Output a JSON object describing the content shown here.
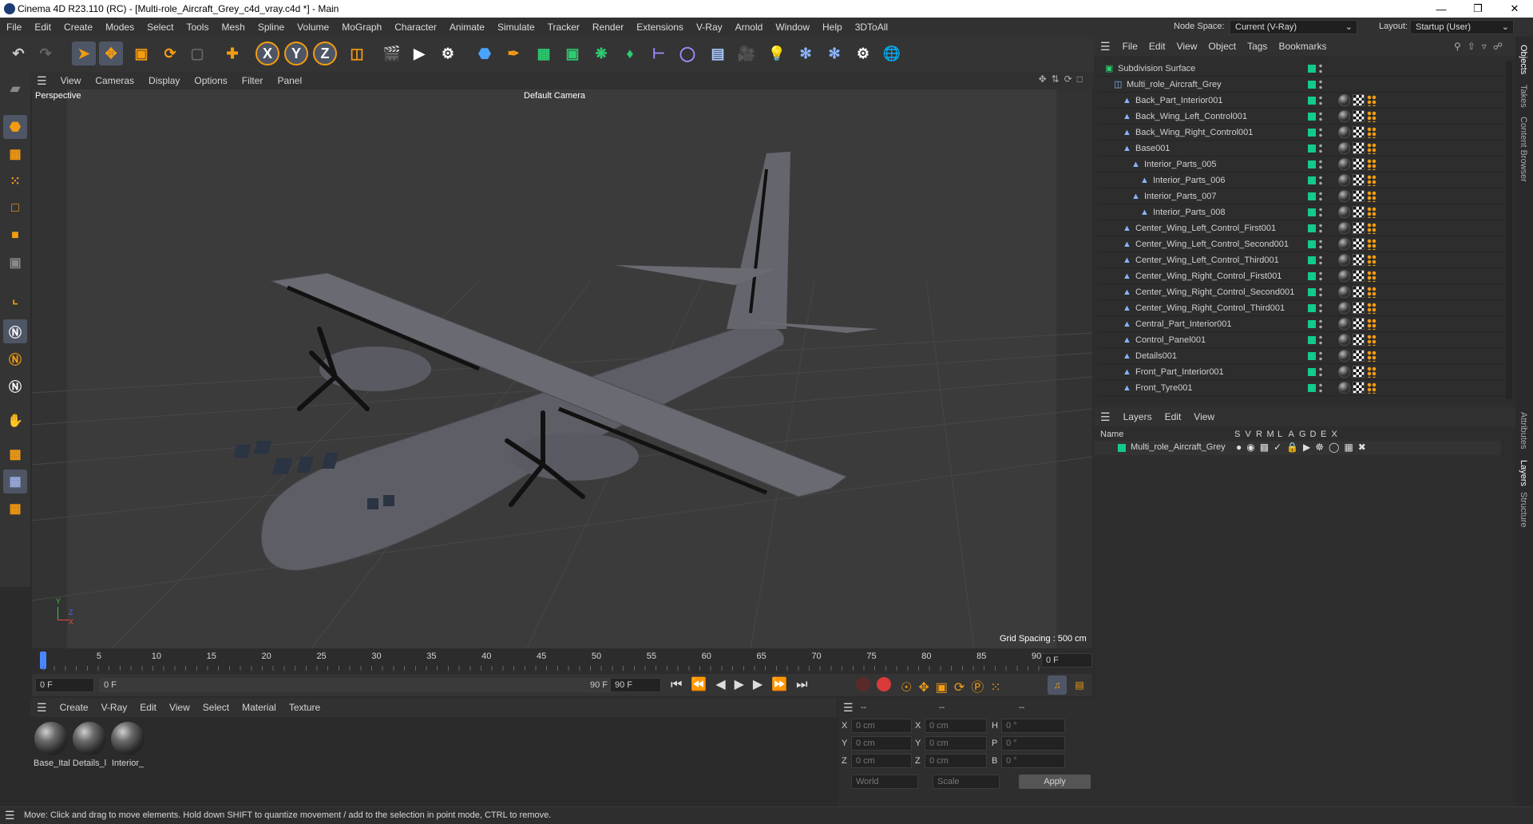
{
  "window": {
    "title": "Cinema 4D R23.110 (RC) - [Multi-role_Aircraft_Grey_c4d_vray.c4d *] - Main"
  },
  "menubar": {
    "items": [
      "File",
      "Edit",
      "Create",
      "Modes",
      "Select",
      "Tools",
      "Mesh",
      "Spline",
      "Volume",
      "MoGraph",
      "Character",
      "Animate",
      "Simulate",
      "Tracker",
      "Render",
      "Extensions",
      "V-Ray",
      "Arnold",
      "Window",
      "Help",
      "3DToAll"
    ],
    "node_space_label": "Node Space:",
    "node_space_value": "Current (V-Ray)",
    "layout_label": "Layout:",
    "layout_value": "Startup (User)"
  },
  "toolbar": {
    "axis_x": "X",
    "axis_y": "Y",
    "axis_z": "Z"
  },
  "viewport": {
    "menu": [
      "View",
      "Cameras",
      "Display",
      "Options",
      "Filter",
      "Panel"
    ],
    "view_name": "Perspective",
    "camera_label": "Default Camera",
    "grid_spacing": "Grid Spacing : 500 cm",
    "axis_labels": {
      "y": "Y",
      "z": "Z",
      "x": "X"
    }
  },
  "timeline": {
    "ticks": [
      "0",
      "5",
      "10",
      "15",
      "20",
      "25",
      "30",
      "35",
      "40",
      "45",
      "50",
      "55",
      "60",
      "65",
      "70",
      "75",
      "80",
      "85",
      "90"
    ],
    "current_frame": "0 F",
    "start_field": "0 F",
    "range_start": "0 F",
    "range_end": "90 F",
    "end_field": "90 F",
    "end_field2": "90 F"
  },
  "materials": {
    "menu": [
      "Create",
      "V-Ray",
      "Edit",
      "View",
      "Select",
      "Material",
      "Texture"
    ],
    "items": [
      {
        "label": "Base_Ital"
      },
      {
        "label": "Details_l"
      },
      {
        "label": "Interior_"
      }
    ]
  },
  "coords": {
    "header": [
      "--",
      "--",
      "--"
    ],
    "rows": [
      {
        "a": "X",
        "av": "0 cm",
        "b": "X",
        "bv": "0 cm",
        "c": "H",
        "cv": "0 °"
      },
      {
        "a": "Y",
        "av": "0 cm",
        "b": "Y",
        "bv": "0 cm",
        "c": "P",
        "cv": "0 °"
      },
      {
        "a": "Z",
        "av": "0 cm",
        "b": "Z",
        "bv": "0 cm",
        "c": "B",
        "cv": "0 °"
      }
    ],
    "world": "World",
    "scale": "Scale",
    "apply": "Apply"
  },
  "objects": {
    "menu": [
      "File",
      "Edit",
      "View",
      "Object",
      "Tags",
      "Bookmarks"
    ],
    "rows": [
      {
        "name": "Subdivision Surface",
        "indent": 0,
        "icon": "subdiv-icon"
      },
      {
        "name": "Multi_role_Aircraft_Grey",
        "indent": 1,
        "icon": "null-icon"
      },
      {
        "name": "Back_Part_Interior001",
        "indent": 2,
        "icon": "mesh-icon"
      },
      {
        "name": "Back_Wing_Left_Control001",
        "indent": 2,
        "icon": "mesh-icon"
      },
      {
        "name": "Back_Wing_Right_Control001",
        "indent": 2,
        "icon": "mesh-icon"
      },
      {
        "name": "Base001",
        "indent": 2,
        "icon": "mesh-icon"
      },
      {
        "name": "Interior_Parts_005",
        "indent": 3,
        "icon": "mesh-icon"
      },
      {
        "name": "Interior_Parts_006",
        "indent": 4,
        "icon": "mesh-icon"
      },
      {
        "name": "Interior_Parts_007",
        "indent": 3,
        "icon": "mesh-icon"
      },
      {
        "name": "Interior_Parts_008",
        "indent": 4,
        "icon": "mesh-icon"
      },
      {
        "name": "Center_Wing_Left_Control_First001",
        "indent": 2,
        "icon": "mesh-icon"
      },
      {
        "name": "Center_Wing_Left_Control_Second001",
        "indent": 2,
        "icon": "mesh-icon"
      },
      {
        "name": "Center_Wing_Left_Control_Third001",
        "indent": 2,
        "icon": "mesh-icon"
      },
      {
        "name": "Center_Wing_Right_Control_First001",
        "indent": 2,
        "icon": "mesh-icon"
      },
      {
        "name": "Center_Wing_Right_Control_Second001",
        "indent": 2,
        "icon": "mesh-icon"
      },
      {
        "name": "Center_Wing_Right_Control_Third001",
        "indent": 2,
        "icon": "mesh-icon"
      },
      {
        "name": "Central_Part_Interior001",
        "indent": 2,
        "icon": "mesh-icon"
      },
      {
        "name": "Control_Panel001",
        "indent": 2,
        "icon": "mesh-icon"
      },
      {
        "name": "Details001",
        "indent": 2,
        "icon": "mesh-icon"
      },
      {
        "name": "Front_Part_Interior001",
        "indent": 2,
        "icon": "mesh-icon"
      },
      {
        "name": "Front_Tyre001",
        "indent": 2,
        "icon": "mesh-icon"
      }
    ]
  },
  "layers": {
    "menu": [
      "Layers",
      "Edit",
      "View"
    ],
    "name_header": "Name",
    "flags": [
      "S",
      "V",
      "R",
      "M",
      "L",
      "A",
      "G",
      "D",
      "E",
      "X"
    ],
    "rows": [
      {
        "name": "Multi_role_Aircraft_Grey",
        "color": "#14c98f"
      }
    ]
  },
  "sidetabs": [
    "Objects",
    "Takes",
    "Content Browser",
    "Attributes",
    "Layers",
    "Structure"
  ],
  "status": "Move: Click and drag to move elements. Hold down SHIFT to quantize movement / add to the selection in point mode, CTRL to remove.",
  "colors": {
    "accent": "#14c98f",
    "selected_tool": "#4e5666",
    "orange": "#f39c12"
  }
}
